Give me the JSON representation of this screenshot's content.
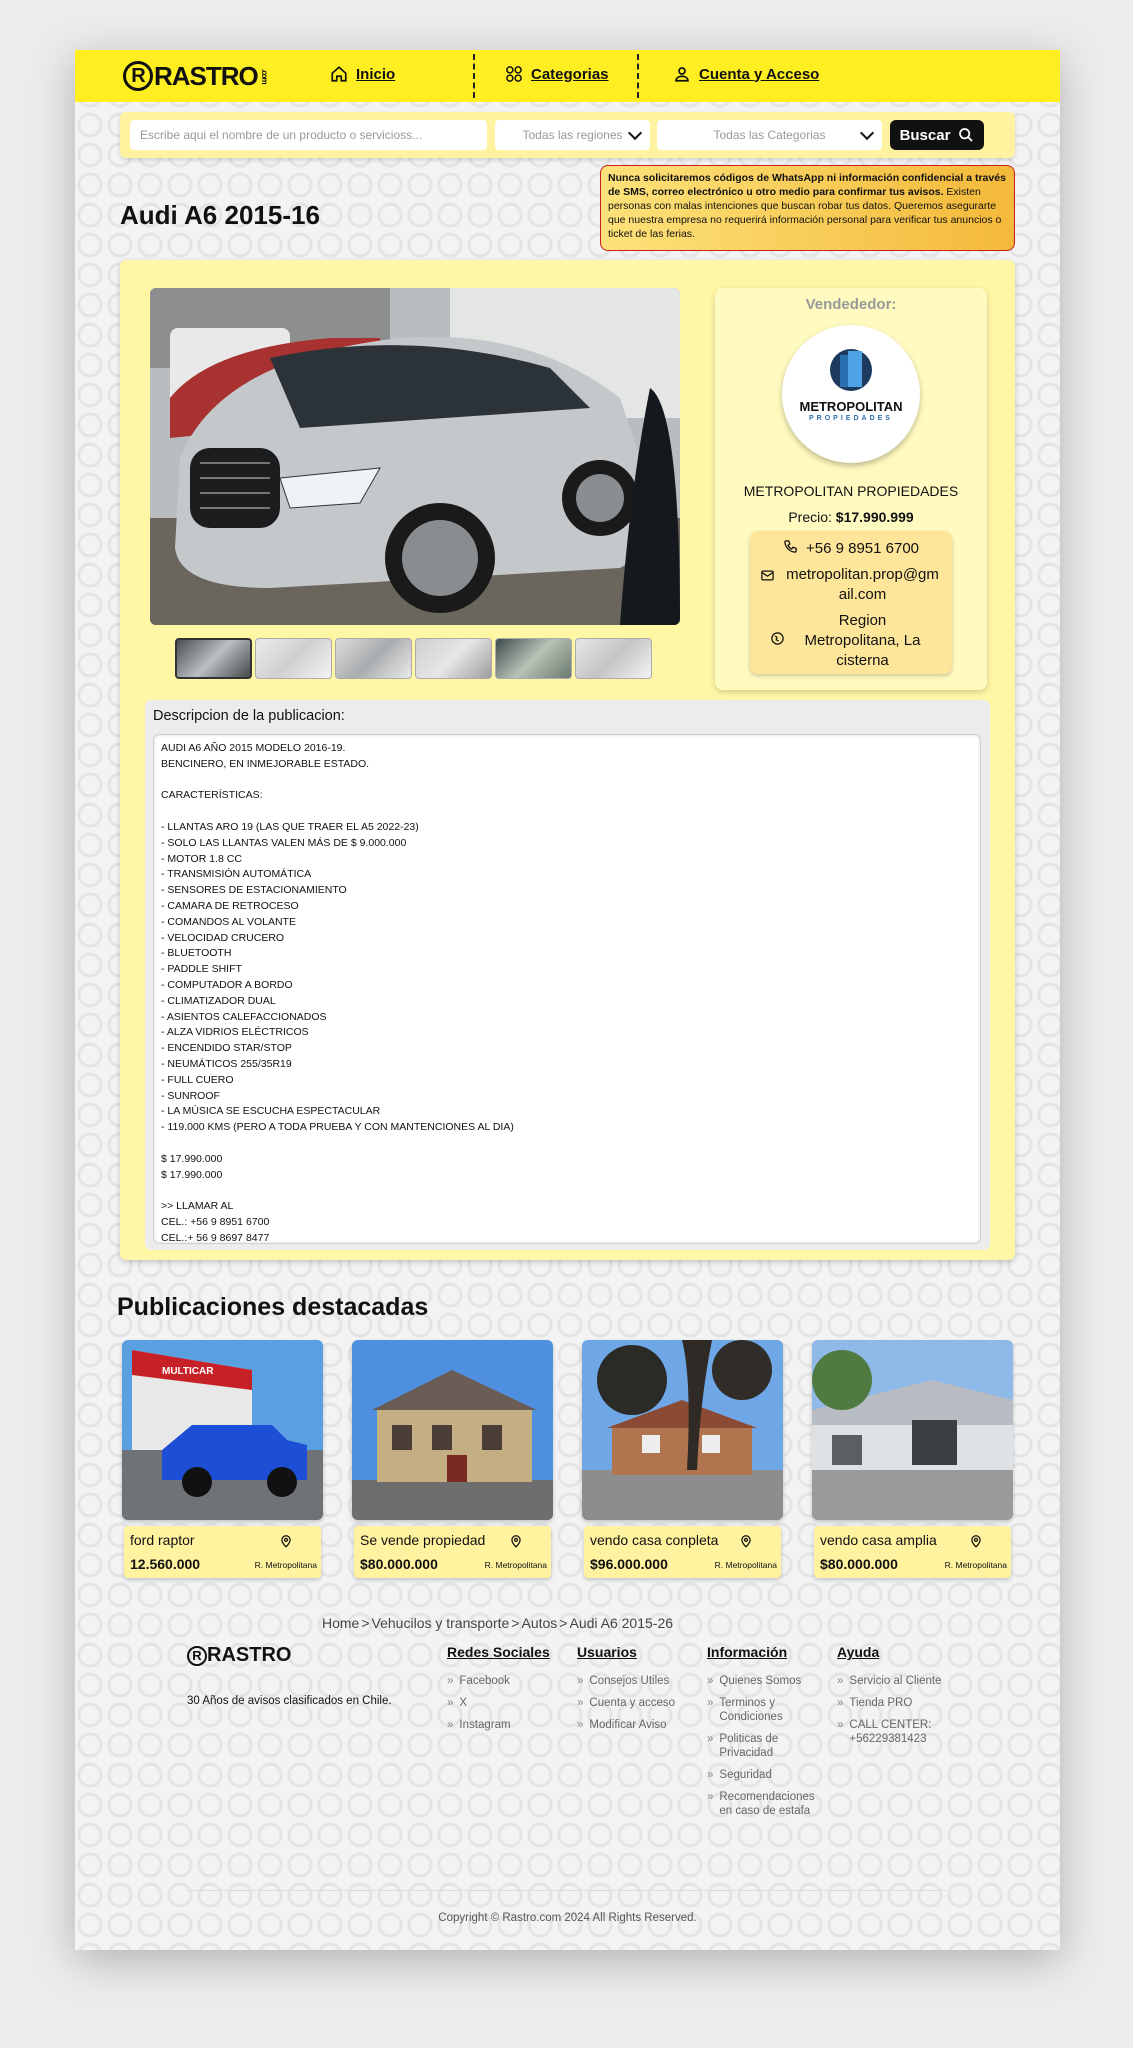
{
  "header": {
    "logo": "RASTRO",
    "logo_r": "R",
    "logo_com": ".com",
    "nav": {
      "home": "Inicio",
      "categories": "Categorias",
      "account": "Cuenta y Acceso"
    }
  },
  "search": {
    "placeholder": "Escribe aqui el nombre de un producto o servicioss...",
    "regions": "Todas las regiones",
    "categories": "Todas las Categorias",
    "button": "Buscar"
  },
  "listing": {
    "title": "Audi A6 2015-16",
    "thumb_count": 6
  },
  "warning": {
    "bold": "Nunca solicitaremos códigos de WhatsApp ni información confidencial a través de SMS, correo electrónico u otro medio para confirmar tus avisos.",
    "text": " Existen personas con malas intenciones que buscan robar tus datos. Queremos asegurarte que nuestra empresa no requerirá información personal para verificar tus anuncios o ticket de las ferias."
  },
  "seller": {
    "label": "Vendededor:",
    "logo_text": "METROPOLITAN",
    "logo_sub": "PROPIEDADES",
    "name": "METROPOLITAN PROPIEDADES",
    "price_label": "Precio:",
    "price": "$17.990.999",
    "phone": "+56 9 8951 6700",
    "email": "metropolitan.prop@gmail.com",
    "region": "Region Metropolitana, La cisterna"
  },
  "description": {
    "title": "Descripcion de la publicacion:",
    "text": "AUDI A6 AÑO 2015 MODELO 2016-19.\nBENCINERO, EN INMEJORABLE ESTADO.\n\nCARACTERÍSTICAS:\n\n- LLANTAS ARO 19 (LAS QUE TRAER EL A5 2022-23)\n- SOLO LAS LLANTAS VALEN MÁS DE $ 9.000.000\n- MOTOR 1.8 CC\n- TRANSMISIÓN AUTOMÁTICA\n- SENSORES DE ESTACIONAMIENTO\n- CAMARA DE RETROCESO\n- COMANDOS AL VOLANTE\n- VELOCIDAD CRUCERO\n- BLUETOOTH\n- PADDLE SHIFT\n- COMPUTADOR A BORDO\n- CLIMATIZADOR DUAL\n- ASIENTOS CALEFACCIONADOS\n- ALZA VIDRIOS ELÉCTRICOS\n- ENCENDIDO STAR/STOP\n- NEUMÁTICOS 255/35R19\n- FULL CUERO\n- SUNROOF\n- LA MÚSICA SE ESCUCHA ESPECTACULAR\n- 119.000 KMS (PERO A TODA PRUEBA Y CON MANTENCIONES AL DIA)\n\n$ 17.990.000\n$ 17.990.000\n\n>> LLAMAR AL\nCEL.: +56 9 8951 6700\nCEL.:+ 56 9 8697 8477"
  },
  "featured": {
    "title": "Publicaciones destacadas",
    "items": [
      {
        "title": "ford raptor",
        "price": "12.560.000",
        "region": "R. Metropolitana"
      },
      {
        "title": "Se vende propiedad",
        "price": "$80.000.000",
        "region": "R. Metropolitana"
      },
      {
        "title": "vendo casa conpleta",
        "price": "$96.000.000",
        "region": "R. Metropolitana"
      },
      {
        "title": "vendo casa amplia",
        "price": "$80.000.000",
        "region": "R. Metropolitana"
      }
    ],
    "sign_text": "MULTICAR"
  },
  "breadcrumb": [
    "Home",
    ">",
    "Vehucilos y transporte",
    ">",
    "Autos",
    ">",
    "Audi A6 2015-26"
  ],
  "footer": {
    "logo": "RASTRO",
    "tagline": "30 Años de avisos clasificados en Chile.",
    "columns": [
      {
        "title": "Redes Sociales",
        "links": [
          "Facebook",
          "X",
          "Instagram"
        ]
      },
      {
        "title": "Usuarios",
        "links": [
          "Consejos Utiles",
          "Cuenta y acceso",
          "Modificar Aviso"
        ]
      },
      {
        "title": "Información",
        "links": [
          "Quienes Somos",
          "Terminos y Condiciones",
          "Politicas de Privacidad",
          "Seguridad",
          "Recomendaciones en caso de estafa"
        ]
      },
      {
        "title": "Ayuda",
        "links": [
          "Servicio al Cliente",
          "Tienda PRO",
          "CALL CENTER: +56229381423"
        ]
      }
    ],
    "copyright": "Copyright © Rastro.com 2024 All Rights Reserved."
  },
  "colors": {
    "brand_yellow": "#ffee22",
    "card_yellow": "#fff6a6",
    "accent_dark": "#111111",
    "warning_border": "#c91f1f"
  }
}
